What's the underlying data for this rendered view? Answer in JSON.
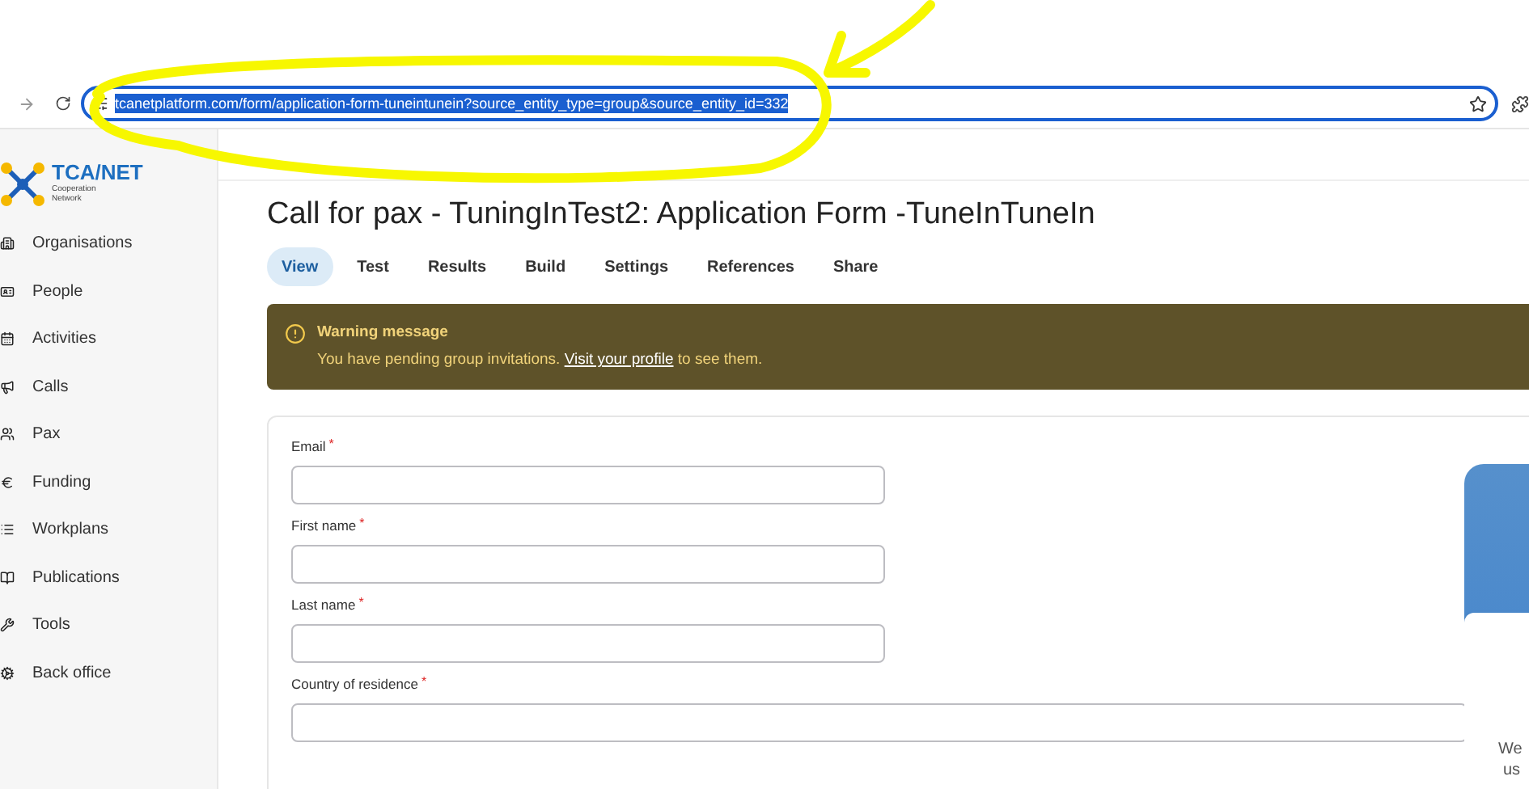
{
  "address_bar": {
    "url": "tcanetplatform.com/form/application-form-tuneintunein?source_entity_type=group&source_entity_id=332",
    "selected": true
  },
  "logo": {
    "name": "TCA/NET",
    "tagline_1": "Cooperation",
    "tagline_2": "Network"
  },
  "sidebar": {
    "items": [
      {
        "label": "Organisations"
      },
      {
        "label": "People"
      },
      {
        "label": "Activities"
      },
      {
        "label": "Calls"
      },
      {
        "label": "Pax"
      },
      {
        "label": "Funding"
      },
      {
        "label": "Workplans"
      },
      {
        "label": "Publications"
      },
      {
        "label": "Tools"
      },
      {
        "label": "Back office"
      }
    ]
  },
  "page": {
    "title": "Call for pax - TuningInTest2: Application Form -TuneInTuneIn"
  },
  "tabs": [
    {
      "label": "View",
      "selected": true
    },
    {
      "label": "Test",
      "selected": false
    },
    {
      "label": "Results",
      "selected": false
    },
    {
      "label": "Build",
      "selected": false
    },
    {
      "label": "Settings",
      "selected": false
    },
    {
      "label": "References",
      "selected": false
    },
    {
      "label": "Share",
      "selected": false
    }
  ],
  "warning": {
    "title": "Warning message",
    "text": "You have pending group invitations.",
    "link": "Visit your profile",
    "suffix": "to see them."
  },
  "form": {
    "fields": [
      {
        "label": "Email",
        "required_mark": "*",
        "kind": "narrow"
      },
      {
        "label": "First name",
        "required_mark": "*",
        "kind": "narrow"
      },
      {
        "label": "Last name",
        "required_mark": "*",
        "kind": "narrow"
      },
      {
        "label": "Country of residence",
        "required_mark": "*",
        "kind": "wide"
      }
    ]
  },
  "chat_widget": {
    "lines": [
      "We",
      "us"
    ]
  }
}
